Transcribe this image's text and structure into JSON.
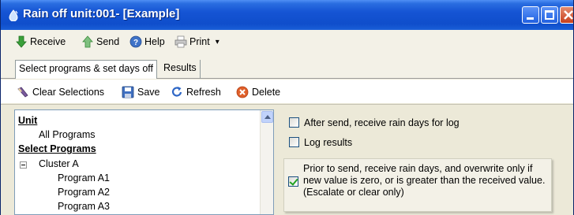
{
  "window": {
    "title": "Rain off unit:001- [Example]"
  },
  "menubar": {
    "receive": "Receive",
    "send": "Send",
    "help": "Help",
    "print": "Print",
    "print_arrow": "▾"
  },
  "tabs": {
    "active": "Select programs & set days off",
    "inactive": "Results"
  },
  "toolbar": {
    "clear": "Clear Selections",
    "save": "Save",
    "refresh": "Refresh",
    "delete": "Delete"
  },
  "tree": {
    "unit_header": "Unit",
    "all_programs": "All Programs",
    "select_header": "Select Programs",
    "cluster": "Cluster A",
    "programs": [
      "Program A1",
      "Program A2",
      "Program A3"
    ]
  },
  "options": {
    "after_send": {
      "label": "After send, receive rain days for log",
      "checked": false
    },
    "log_results": {
      "label": "Log results",
      "checked": false
    },
    "overwrite": {
      "label": "Prior to send, receive rain days, and overwrite only if new value is zero, or  is greater than the received value. (Escalate or clear only)",
      "checked": true
    }
  },
  "colors": {
    "titlebar": "#1554d4",
    "window_bg": "#ece9d8",
    "receive_arrow": "#3aa03a",
    "delete": "#e0602a"
  },
  "icons": {
    "app": "rain-drop-icon",
    "receive": "green-down-arrow-icon",
    "send": "green-up-arrow-icon",
    "help": "help-icon",
    "print": "printer-icon",
    "clear": "eraser-icon",
    "save": "floppy-disk-icon",
    "refresh": "refresh-icon",
    "delete": "delete-icon"
  }
}
